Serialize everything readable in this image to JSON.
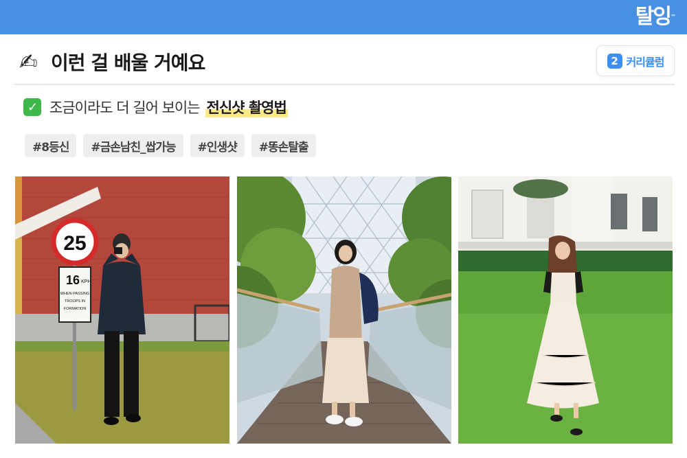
{
  "brand": {
    "name": "탈잉",
    "trademark": "™"
  },
  "header": {
    "icon": "writing-hand-icon",
    "title": "이런 걸 배울 거예요"
  },
  "curriculum": {
    "number": "2",
    "label": "커리큘럼"
  },
  "subtitle": {
    "icon": "check-mark-button-icon",
    "check_glyph": "✓",
    "text": "조금이라도 더 길어 보이는",
    "highlight": "전신샷 촬영법"
  },
  "tags": [
    "#8등신",
    "#금손남친_쌉가능",
    "#인생샷",
    "#똥손탈출"
  ],
  "photos": {
    "speed_sign": {
      "top": "25",
      "speed": "16",
      "unit": "KPH",
      "line1": "WHEN PASSING",
      "line2": "TROOPS IN",
      "line3": "FORMATION"
    }
  },
  "colors": {
    "topbar": "#4a90e2",
    "accent": "#3d8ff0",
    "highlight": "#fde98a",
    "check": "#3eb84a"
  }
}
